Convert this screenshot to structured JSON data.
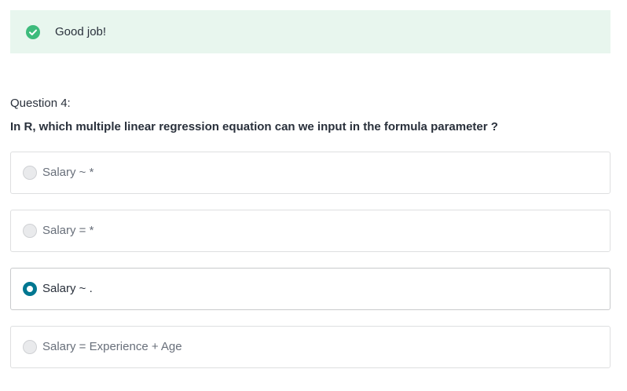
{
  "alert": {
    "message": "Good job!",
    "icon": "check-circle-icon",
    "color": "#3dbb7c",
    "background": "#e8f6ee"
  },
  "question": {
    "number": "Question 4:",
    "text": "In R, which multiple linear regression equation can we input in the formula parameter ?"
  },
  "options": [
    {
      "label": "Salary ~ *",
      "selected": false
    },
    {
      "label": "Salary = *",
      "selected": false
    },
    {
      "label": "Salary ~ .",
      "selected": true
    },
    {
      "label": "Salary = Experience + Age",
      "selected": false
    }
  ],
  "colors": {
    "accent": "#007791",
    "text": "#29303b",
    "muted_text": "#686f7a"
  }
}
